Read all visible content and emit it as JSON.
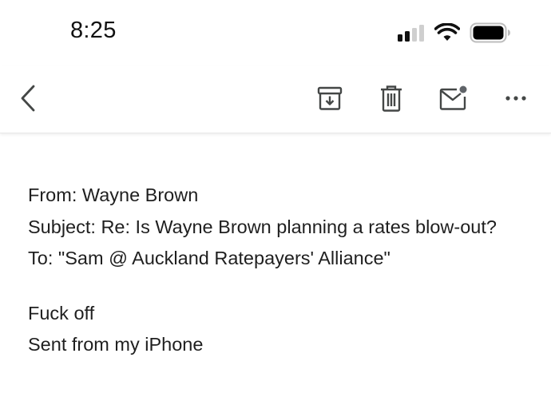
{
  "status_bar": {
    "time": "8:25",
    "icons": [
      "signal-icon",
      "wifi-icon",
      "battery-icon"
    ]
  },
  "toolbar": {
    "icons": [
      "back-icon",
      "archive-icon",
      "delete-icon",
      "mark-unread-icon",
      "more-icon"
    ]
  },
  "email": {
    "from": "From: Wayne Brown",
    "subject": "Subject: Re: Is Wayne Brown planning a rates blow-out?",
    "to": "To: \"Sam @ Auckland Ratepayers' Alliance\"",
    "body_line_1": "Fuck off",
    "body_line_2": "Sent from my iPhone"
  },
  "colors": {
    "icon": "#444746",
    "text": "#1f1f1f",
    "unread_dot": "#5f6368"
  }
}
